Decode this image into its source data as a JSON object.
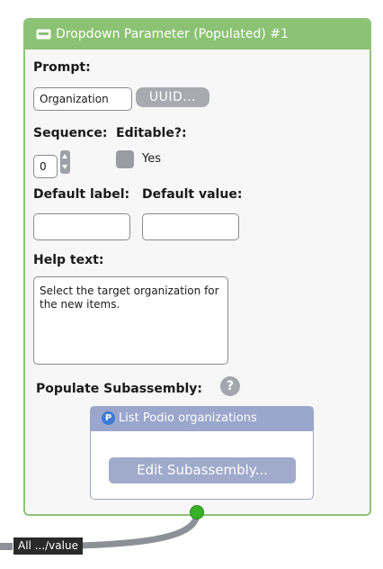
{
  "node": {
    "title": "Dropdown Parameter (Populated) #1",
    "header_icon": "keyboard-field-icon",
    "header_color": "#8cc273"
  },
  "prompt": {
    "label": "Prompt:",
    "value": "Organization",
    "uuid_button": "UUID..."
  },
  "sequence": {
    "label": "Sequence:",
    "value": "0"
  },
  "editable": {
    "label": "Editable?:",
    "option_label": "Yes"
  },
  "default_label": {
    "label": "Default label:",
    "value": ""
  },
  "default_value": {
    "label": "Default value:",
    "value": ""
  },
  "help_text": {
    "label": "Help text:",
    "value": "Select the target organization for the new items."
  },
  "subassembly": {
    "label": "Populate Subassembly:",
    "help_icon": "?",
    "name": "List Podio organizations",
    "icon_letter": "P",
    "edit_button": "Edit Subassembly...",
    "header_color": "#9aa6cb"
  },
  "wire": {
    "label": "All .../value",
    "port_color": "#38b027"
  }
}
